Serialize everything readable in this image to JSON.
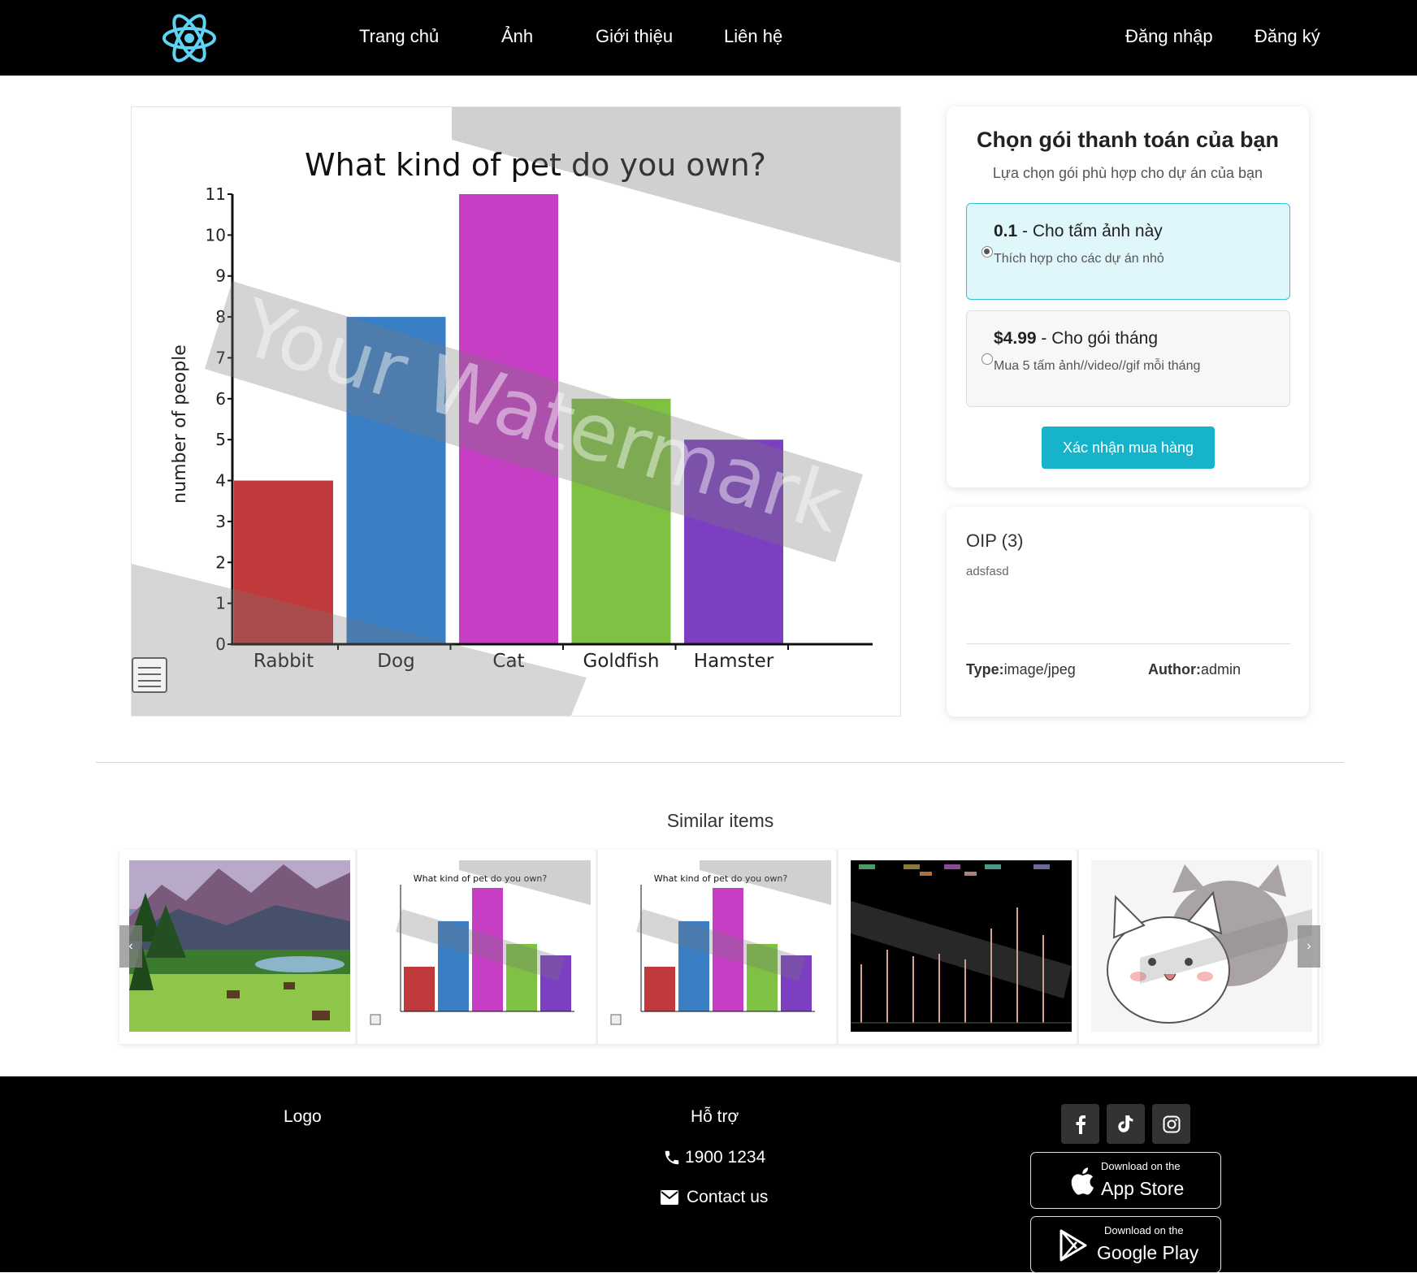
{
  "nav": {
    "links": [
      "Trang chủ",
      "Ảnh",
      "Giới thiệu",
      "Liên hệ"
    ],
    "login": "Đăng nhập",
    "register": "Đăng ký"
  },
  "main_image": {
    "chart_data": {
      "type": "bar",
      "title": "What kind of pet do you own?",
      "ylabel": "number of people",
      "xlabel": "",
      "categories": [
        "Rabbit",
        "Dog",
        "Cat",
        "Goldfish",
        "Hamster"
      ],
      "values": [
        4,
        8,
        11,
        6,
        5
      ],
      "colors": [
        "#c0393b",
        "#3a7ec4",
        "#c53ec3",
        "#7fc142",
        "#7d3fc2"
      ],
      "ylim": [
        0,
        11
      ],
      "yticks": [
        "0",
        "1",
        "2",
        "3",
        "4",
        "5",
        "6",
        "7",
        "8",
        "9",
        "10",
        "11"
      ],
      "grid": false
    },
    "watermark": "Your Watermark"
  },
  "payment": {
    "title": "Chọn gói thanh toán của bạn",
    "subtitle": "Lựa chọn gói phù hợp cho dự án của bạn",
    "plans": [
      {
        "price": "0.1",
        "name": " - Cho tấm ảnh này",
        "desc": "Thích hợp cho các dự án nhỏ",
        "selected": true
      },
      {
        "price": "$4.99",
        "name": " - Cho gói tháng",
        "desc": "Mua 5 tấm ảnh//video//gif mỗi tháng",
        "selected": false
      }
    ],
    "confirm_label": "Xác nhận mua hàng",
    "accent_color": "#16b3cb"
  },
  "info": {
    "title": "OIP (3)",
    "description": "adsfasd",
    "type_label": "Type:",
    "type_value": "image/jpeg",
    "author_label": "Author:",
    "author_value": "admin"
  },
  "similar": {
    "title": "Similar items",
    "prev_icon": "‹",
    "next_icon": "›",
    "items": [
      {
        "kind": "landscape"
      },
      {
        "kind": "pet-chart",
        "caption": "What kind of pet do you own?"
      },
      {
        "kind": "pet-chart",
        "caption": "What kind of pet do you own?"
      },
      {
        "kind": "dark-chart"
      },
      {
        "kind": "cat-sticker"
      }
    ]
  },
  "footer": {
    "logo": "Logo",
    "support_title": "Hỗ trợ",
    "phone": "1900 1234",
    "contact": "Contact us",
    "social_icons": [
      "facebook-icon",
      "tiktok-icon",
      "instagram-icon"
    ],
    "app_store_small": "Download on the",
    "app_store_big": "App Store",
    "google_play_small": "Download on the",
    "google_play_big": "Google Play"
  }
}
